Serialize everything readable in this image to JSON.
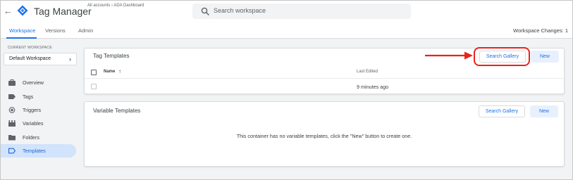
{
  "app": {
    "title": "Tag Manager",
    "breadcrumb": "All accounts  ›  ADA Dashboard",
    "search_placeholder": "Search workspace"
  },
  "tabs": [
    {
      "label": "Workspace",
      "active": true
    },
    {
      "label": "Versions",
      "active": false
    },
    {
      "label": "Admin",
      "active": false
    }
  ],
  "workspace_changes_label": "Workspace Changes: 1",
  "sidebar": {
    "current_workspace_label": "CURRENT WORKSPACE",
    "workspace_name": "Default Workspace",
    "items": [
      {
        "label": "Overview",
        "icon": "briefcase-icon",
        "active": false
      },
      {
        "label": "Tags",
        "icon": "tag-icon",
        "active": false
      },
      {
        "label": "Triggers",
        "icon": "trigger-icon",
        "active": false
      },
      {
        "label": "Variables",
        "icon": "variables-icon",
        "active": false
      },
      {
        "label": "Folders",
        "icon": "folder-icon",
        "active": false
      },
      {
        "label": "Templates",
        "icon": "template-icon",
        "active": true
      }
    ]
  },
  "tag_templates": {
    "title": "Tag Templates",
    "search_gallery_label": "Search Gallery",
    "new_label": "New",
    "columns": {
      "name": "Name",
      "last_edited": "Last Edited"
    },
    "rows": [
      {
        "name": "",
        "last_edited": "9 minutes ago"
      }
    ]
  },
  "variable_templates": {
    "title": "Variable Templates",
    "search_gallery_label": "Search Gallery",
    "new_label": "New",
    "empty_message": "This container has no variable templates, click the \"New\" button to create one."
  },
  "colors": {
    "accent": "#1a73e8",
    "annotation": "#e8231a",
    "sidebar_bg": "#f1f3f4",
    "active_nav_bg": "#d2e3fc"
  }
}
